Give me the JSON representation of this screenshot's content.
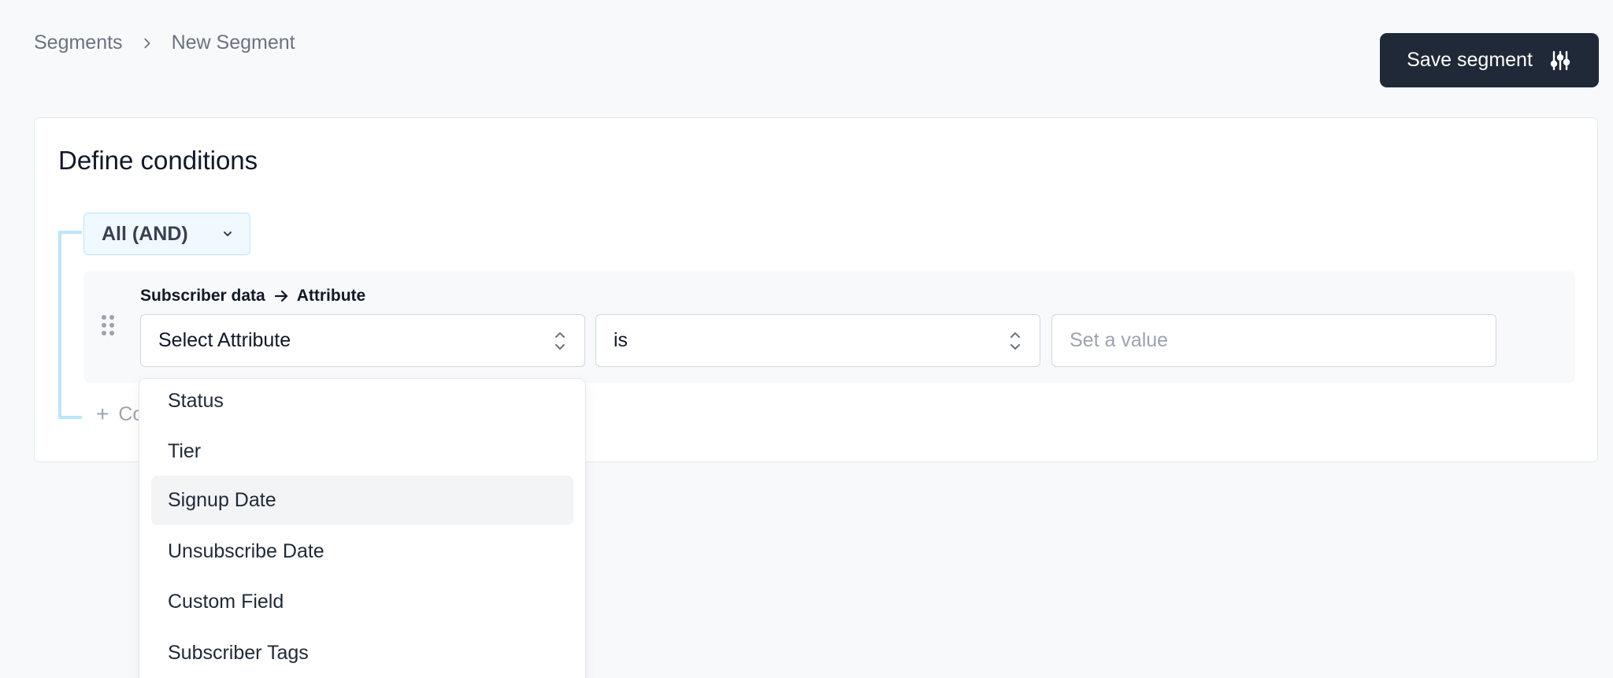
{
  "breadcrumb": {
    "root": "Segments",
    "current": "New Segment"
  },
  "header": {
    "save_label": "Save segment",
    "save_icon": "sliders-icon"
  },
  "card": {
    "title": "Define conditions"
  },
  "group": {
    "logic_value": "All (AND)",
    "logic_icon": "chevron-down-icon",
    "bracket_color": "#bae6fd"
  },
  "condition": {
    "label_source": "Subscriber data",
    "label_target": "Attribute",
    "attribute_value": "Select Attribute",
    "operator_value": "is",
    "value_placeholder": "Set a value"
  },
  "add_condition": {
    "label": "Co"
  },
  "menu": {
    "items": [
      {
        "label": "Status",
        "active": false
      },
      {
        "label": "Tier",
        "active": false
      },
      {
        "label": "Signup Date",
        "active": true
      },
      {
        "label": "Unsubscribe Date",
        "active": false
      },
      {
        "label": "Custom Field",
        "active": false
      },
      {
        "label": "Subscriber Tags",
        "active": false
      }
    ]
  },
  "colors": {
    "primary_button": "#1f2937",
    "page_background": "#f8f9fb",
    "accent_light": "#f0f9ff"
  }
}
